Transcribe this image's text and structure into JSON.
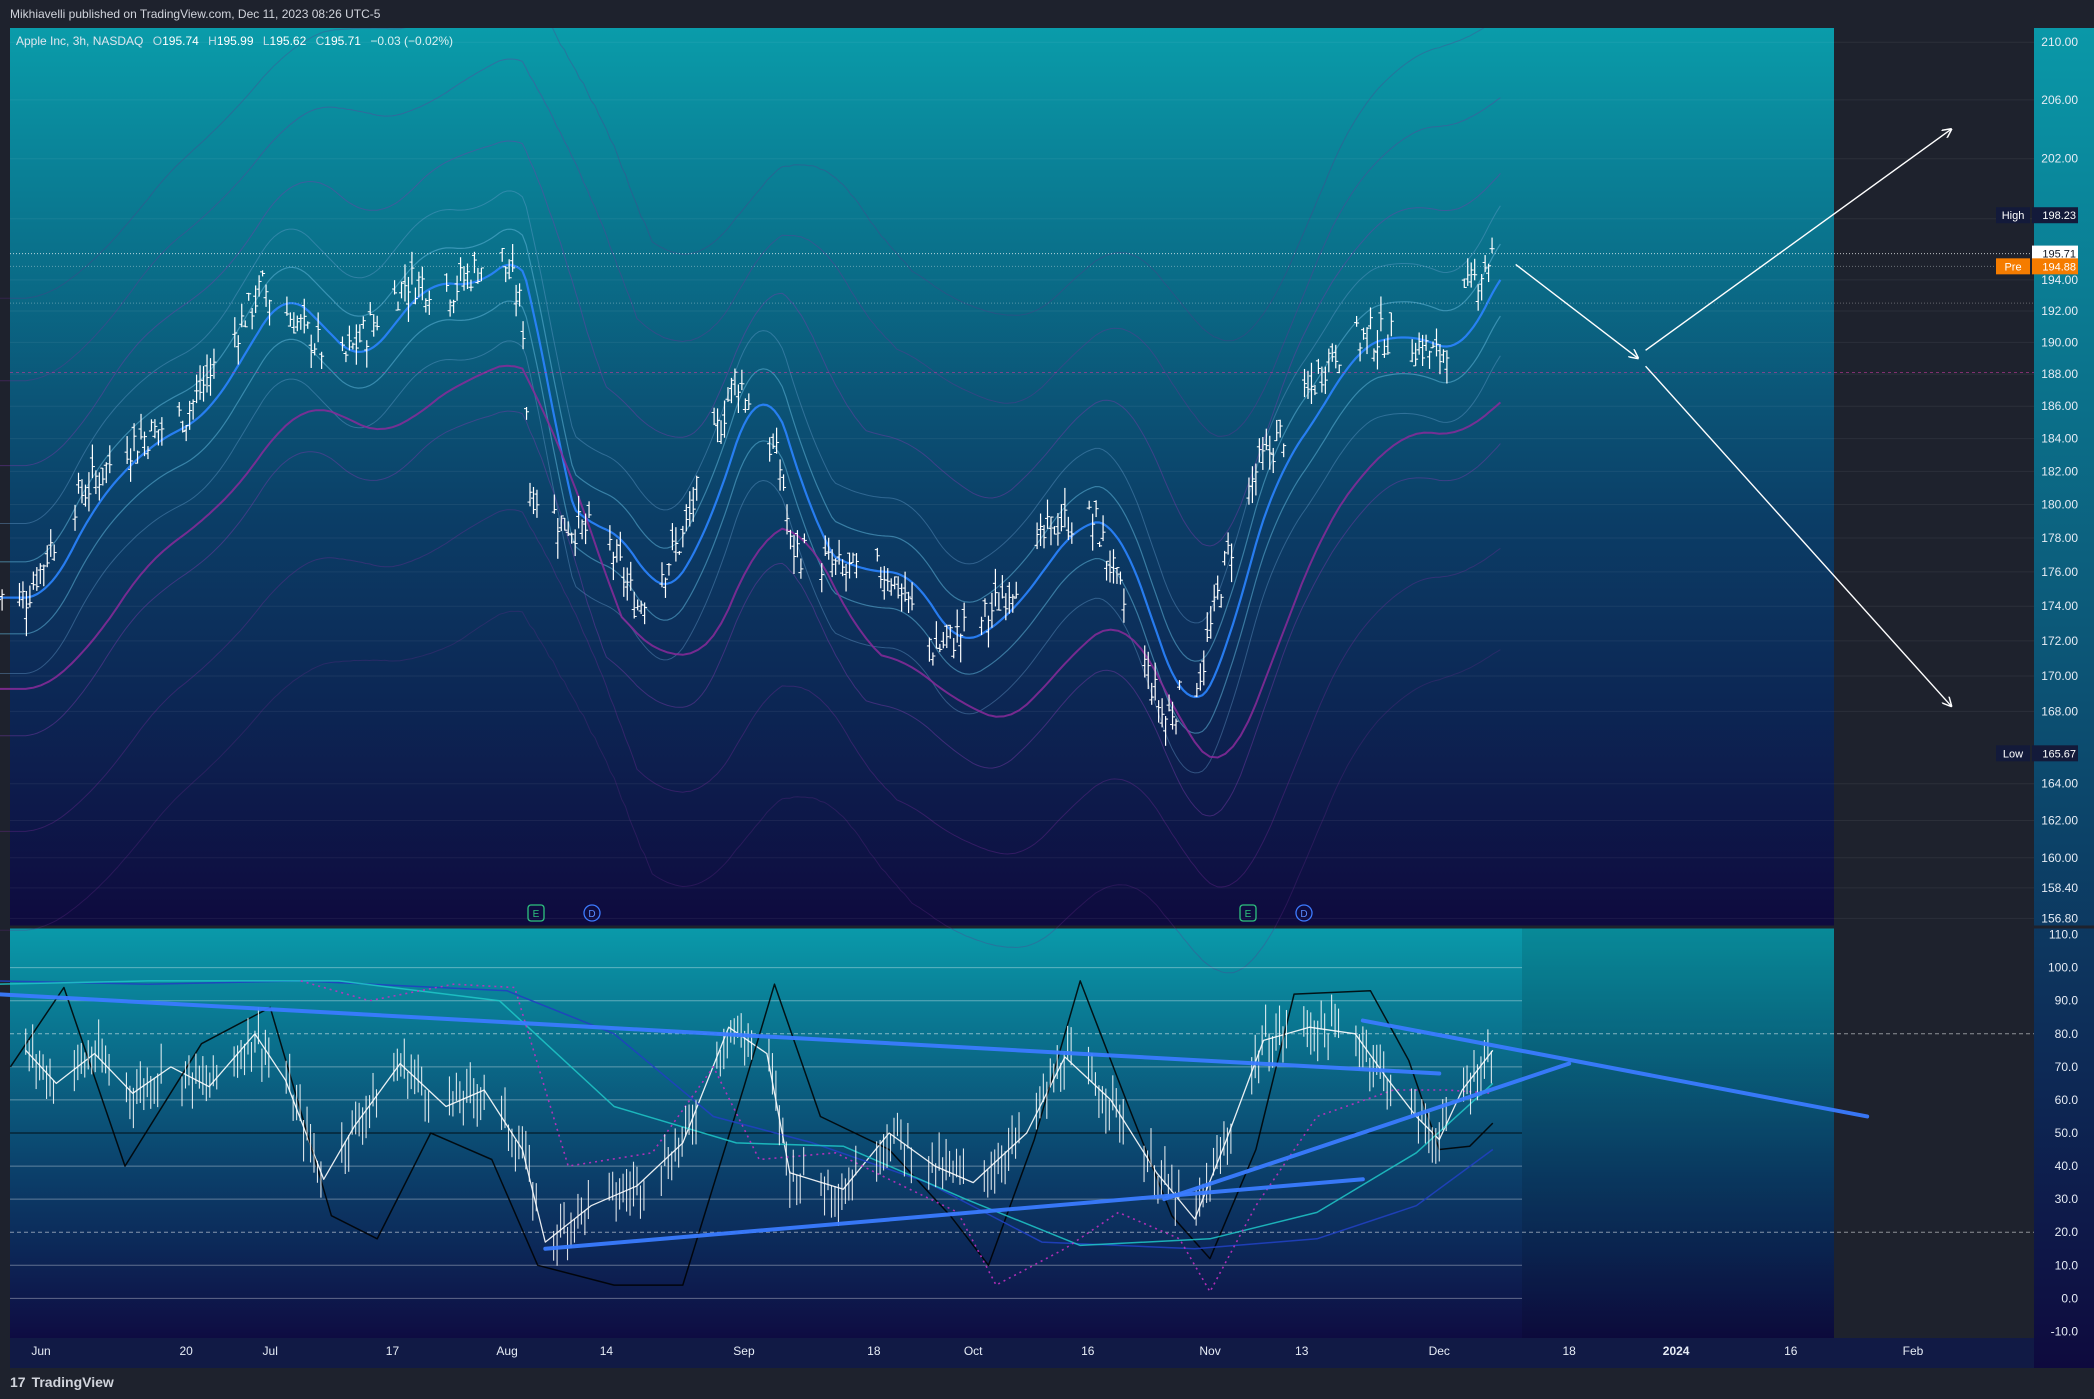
{
  "header": {
    "publisher_line": "Mikhiavelli published on TradingView.com, Dec 11, 2023 08:26 UTC-5"
  },
  "legend": {
    "symbol": "Apple Inc, 3h, NASDAQ",
    "open_label": "O",
    "open": "195.74",
    "high_label": "H",
    "high": "195.99",
    "low_label": "L",
    "low": "195.62",
    "close_label": "C",
    "close": "195.71",
    "change": "−0.03 (−0.02%)"
  },
  "price_markers": {
    "high_label": "High",
    "high": "198.23",
    "last": "195.71",
    "pre_label": "Pre",
    "pre": "194.88",
    "low_label": "Low",
    "low": "165.67"
  },
  "event_markers": [
    "E",
    "D",
    "E",
    "D"
  ],
  "footer": {
    "brand": "TradingView",
    "brand_logo": "17"
  },
  "colors": {
    "bg_top": "#0a9aaa",
    "bg_bottom": "#0e0a3e",
    "candles": "#ffffff",
    "band_blue": "#2a84ff",
    "band_purple": "#8a2a9a",
    "pre_badge": "#f57c00"
  },
  "chart_data": [
    {
      "type": "candlestick",
      "title": "Apple Inc, 3h, NASDAQ",
      "x_ticks": [
        "Jun",
        "20",
        "Jul",
        "17",
        "Aug",
        "14",
        "Sep",
        "18",
        "Oct",
        "16",
        "Nov",
        "13",
        "Dec",
        "18",
        "2024",
        "16",
        "Feb"
      ],
      "y_ticks": [
        210.0,
        206.0,
        202.0,
        198.0,
        194.0,
        192.0,
        190.0,
        188.0,
        186.0,
        184.0,
        182.0,
        180.0,
        178.0,
        176.0,
        174.0,
        172.0,
        170.0,
        168.0,
        164.0,
        162.0,
        160.0,
        158.4,
        156.8
      ],
      "ylim": [
        156.4,
        211.0
      ],
      "y_scale": "log",
      "approx_close_path": [
        {
          "date": "2023-05-30",
          "close": 174.5
        },
        {
          "date": "2023-06-05",
          "close": 180.0
        },
        {
          "date": "2023-06-12",
          "close": 183.5
        },
        {
          "date": "2023-06-20",
          "close": 185.5
        },
        {
          "date": "2023-06-30",
          "close": 193.5
        },
        {
          "date": "2023-07-05",
          "close": 191.0
        },
        {
          "date": "2023-07-10",
          "close": 188.5
        },
        {
          "date": "2023-07-14",
          "close": 191.0
        },
        {
          "date": "2023-07-19",
          "close": 194.0
        },
        {
          "date": "2023-07-25",
          "close": 193.5
        },
        {
          "date": "2023-07-31",
          "close": 196.0
        },
        {
          "date": "2023-08-03",
          "close": 192.0
        },
        {
          "date": "2023-08-04",
          "close": 181.0
        },
        {
          "date": "2023-08-08",
          "close": 179.0
        },
        {
          "date": "2023-08-14",
          "close": 178.0
        },
        {
          "date": "2023-08-18",
          "close": 174.0
        },
        {
          "date": "2023-08-24",
          "close": 178.0
        },
        {
          "date": "2023-08-31",
          "close": 188.0
        },
        {
          "date": "2023-09-06",
          "close": 182.0
        },
        {
          "date": "2023-09-07",
          "close": 177.5
        },
        {
          "date": "2023-09-14",
          "close": 176.0
        },
        {
          "date": "2023-09-20",
          "close": 176.0
        },
        {
          "date": "2023-09-26",
          "close": 171.5
        },
        {
          "date": "2023-10-03",
          "close": 173.5
        },
        {
          "date": "2023-10-12",
          "close": 179.0
        },
        {
          "date": "2023-10-17",
          "close": 179.0
        },
        {
          "date": "2023-10-20",
          "close": 175.0
        },
        {
          "date": "2023-10-26",
          "close": 167.5
        },
        {
          "date": "2023-10-31",
          "close": 170.5
        },
        {
          "date": "2023-11-03",
          "close": 176.5
        },
        {
          "date": "2023-11-07",
          "close": 182.0
        },
        {
          "date": "2023-11-13",
          "close": 186.0
        },
        {
          "date": "2023-11-17",
          "close": 189.5
        },
        {
          "date": "2023-11-22",
          "close": 190.5
        },
        {
          "date": "2023-11-28",
          "close": 190.0
        },
        {
          "date": "2023-12-01",
          "close": 189.0
        },
        {
          "date": "2023-12-05",
          "close": 193.5
        },
        {
          "date": "2023-12-08",
          "close": 195.71
        }
      ],
      "levels": {
        "high": 198.23,
        "last": 195.71,
        "pre": 194.88,
        "low": 165.67
      },
      "annotations": [
        {
          "type": "arrow",
          "from": {
            "date": "2023-12-11",
            "price": 195.0
          },
          "to": {
            "date": "2023-12-27",
            "price": 189.0
          }
        },
        {
          "type": "arrow",
          "from": {
            "date": "2023-12-28",
            "price": 189.5
          },
          "to": {
            "date": "2024-02-06",
            "price": 204.0
          }
        },
        {
          "type": "arrow",
          "from": {
            "date": "2023-12-28",
            "price": 188.5
          },
          "to": {
            "date": "2024-02-06",
            "price": 168.3
          }
        }
      ]
    },
    {
      "type": "line",
      "y_ticks": [
        110.0,
        100.0,
        90.0,
        80.0,
        70.0,
        60.0,
        50.0,
        40.0,
        30.0,
        20.0,
        10.0,
        0.0,
        -10.0
      ],
      "ylim": [
        -12,
        112
      ],
      "reference_levels": [
        100,
        90,
        80,
        70,
        60,
        50,
        40,
        30,
        20,
        10,
        0
      ],
      "trendlines": [
        {
          "from": {
            "date": "2023-05-26",
            "value": 92
          },
          "to": {
            "date": "2023-12-01",
            "value": 68
          }
        },
        {
          "from": {
            "date": "2023-08-06",
            "value": 15
          },
          "to": {
            "date": "2023-11-21",
            "value": 36
          }
        },
        {
          "from": {
            "date": "2023-11-21",
            "value": 84
          },
          "to": {
            "date": "2024-01-26",
            "value": 55
          }
        },
        {
          "from": {
            "date": "2023-10-26",
            "value": 30
          },
          "to": {
            "date": "2023-12-18",
            "value": 71
          }
        }
      ],
      "series": [
        {
          "points": [
            {
              "date": "2023-05-30",
              "value": 75
            },
            {
              "date": "2023-06-03",
              "value": 65
            },
            {
              "date": "2023-06-08",
              "value": 74
            },
            {
              "date": "2023-06-13",
              "value": 62
            },
            {
              "date": "2023-06-18",
              "value": 70
            },
            {
              "date": "2023-06-23",
              "value": 64
            },
            {
              "date": "2023-06-29",
              "value": 80
            },
            {
              "date": "2023-07-03",
              "value": 66
            },
            {
              "date": "2023-07-08",
              "value": 36
            },
            {
              "date": "2023-07-12",
              "value": 52
            },
            {
              "date": "2023-07-18",
              "value": 71
            },
            {
              "date": "2023-07-24",
              "value": 58
            },
            {
              "date": "2023-07-29",
              "value": 63
            },
            {
              "date": "2023-08-03",
              "value": 45
            },
            {
              "date": "2023-08-06",
              "value": 17
            },
            {
              "date": "2023-08-12",
              "value": 28
            },
            {
              "date": "2023-08-18",
              "value": 34
            },
            {
              "date": "2023-08-24",
              "value": 47
            },
            {
              "date": "2023-08-30",
              "value": 82
            },
            {
              "date": "2023-09-04",
              "value": 74
            },
            {
              "date": "2023-09-07",
              "value": 38
            },
            {
              "date": "2023-09-14",
              "value": 33
            },
            {
              "date": "2023-09-20",
              "value": 50
            },
            {
              "date": "2023-09-26",
              "value": 40
            },
            {
              "date": "2023-10-01",
              "value": 35
            },
            {
              "date": "2023-10-08",
              "value": 50
            },
            {
              "date": "2023-10-13",
              "value": 73
            },
            {
              "date": "2023-10-19",
              "value": 60
            },
            {
              "date": "2023-10-25",
              "value": 38
            },
            {
              "date": "2023-10-30",
              "value": 24
            },
            {
              "date": "2023-11-03",
              "value": 47
            },
            {
              "date": "2023-11-08",
              "value": 78
            },
            {
              "date": "2023-11-14",
              "value": 82
            },
            {
              "date": "2023-11-20",
              "value": 80
            },
            {
              "date": "2023-11-24",
              "value": 67
            },
            {
              "date": "2023-11-28",
              "value": 55
            },
            {
              "date": "2023-12-01",
              "value": 48
            },
            {
              "date": "2023-12-04",
              "value": 63
            },
            {
              "date": "2023-12-08",
              "value": 75
            }
          ]
        },
        {
          "points": [
            {
              "date": "2023-05-28",
              "value": 70
            },
            {
              "date": "2023-06-04",
              "value": 94
            },
            {
              "date": "2023-06-12",
              "value": 40
            },
            {
              "date": "2023-06-22",
              "value": 77
            },
            {
              "date": "2023-07-01",
              "value": 88
            },
            {
              "date": "2023-07-09",
              "value": 25
            },
            {
              "date": "2023-07-15",
              "value": 18
            },
            {
              "date": "2023-07-22",
              "value": 50
            },
            {
              "date": "2023-07-30",
              "value": 42
            },
            {
              "date": "2023-08-05",
              "value": 10
            },
            {
              "date": "2023-08-15",
              "value": 4
            },
            {
              "date": "2023-08-24",
              "value": 4
            },
            {
              "date": "2023-09-01",
              "value": 64
            },
            {
              "date": "2023-09-05",
              "value": 95
            },
            {
              "date": "2023-09-11",
              "value": 55
            },
            {
              "date": "2023-09-20",
              "value": 45
            },
            {
              "date": "2023-09-28",
              "value": 25
            },
            {
              "date": "2023-10-03",
              "value": 10
            },
            {
              "date": "2023-10-09",
              "value": 48
            },
            {
              "date": "2023-10-15",
              "value": 96
            },
            {
              "date": "2023-10-21",
              "value": 60
            },
            {
              "date": "2023-10-27",
              "value": 25
            },
            {
              "date": "2023-11-01",
              "value": 12
            },
            {
              "date": "2023-11-07",
              "value": 45
            },
            {
              "date": "2023-11-12",
              "value": 92
            },
            {
              "date": "2023-11-22",
              "value": 93
            },
            {
              "date": "2023-11-27",
              "value": 72
            },
            {
              "date": "2023-12-01",
              "value": 45
            },
            {
              "date": "2023-12-05",
              "value": 46
            },
            {
              "date": "2023-12-08",
              "value": 53
            }
          ]
        },
        {
          "points": [
            {
              "date": "2023-05-26",
              "value": 96
            },
            {
              "date": "2023-06-15",
              "value": 95
            },
            {
              "date": "2023-07-05",
              "value": 96
            },
            {
              "date": "2023-08-01",
              "value": 93
            },
            {
              "date": "2023-08-15",
              "value": 80
            },
            {
              "date": "2023-08-28",
              "value": 55
            },
            {
              "date": "2023-09-10",
              "value": 47
            },
            {
              "date": "2023-09-25",
              "value": 35
            },
            {
              "date": "2023-10-10",
              "value": 17
            },
            {
              "date": "2023-10-30",
              "value": 15
            },
            {
              "date": "2023-11-15",
              "value": 18
            },
            {
              "date": "2023-11-28",
              "value": 28
            },
            {
              "date": "2023-12-08",
              "value": 45
            }
          ]
        },
        {
          "points": [
            {
              "date": "2023-05-26",
              "value": 95
            },
            {
              "date": "2023-06-15",
              "value": 96
            },
            {
              "date": "2023-07-10",
              "value": 96
            },
            {
              "date": "2023-07-31",
              "value": 90
            },
            {
              "date": "2023-08-15",
              "value": 58
            },
            {
              "date": "2023-08-31",
              "value": 47
            },
            {
              "date": "2023-09-14",
              "value": 46
            },
            {
              "date": "2023-09-30",
              "value": 30
            },
            {
              "date": "2023-10-15",
              "value": 16
            },
            {
              "date": "2023-11-01",
              "value": 18
            },
            {
              "date": "2023-11-15",
              "value": 26
            },
            {
              "date": "2023-11-28",
              "value": 44
            },
            {
              "date": "2023-12-08",
              "value": 65
            }
          ]
        },
        {
          "points": [
            {
              "date": "2023-07-05",
              "value": 96
            },
            {
              "date": "2023-07-14",
              "value": 90
            },
            {
              "date": "2023-07-25",
              "value": 95
            },
            {
              "date": "2023-08-02",
              "value": 94
            },
            {
              "date": "2023-08-09",
              "value": 40
            },
            {
              "date": "2023-08-20",
              "value": 44
            },
            {
              "date": "2023-08-28",
              "value": 70
            },
            {
              "date": "2023-09-03",
              "value": 42
            },
            {
              "date": "2023-09-13",
              "value": 44
            },
            {
              "date": "2023-09-20",
              "value": 36
            },
            {
              "date": "2023-09-29",
              "value": 26
            },
            {
              "date": "2023-10-04",
              "value": 4
            },
            {
              "date": "2023-10-13",
              "value": 15
            },
            {
              "date": "2023-10-20",
              "value": 26
            },
            {
              "date": "2023-10-28",
              "value": 18
            },
            {
              "date": "2023-11-01",
              "value": 2
            },
            {
              "date": "2023-11-07",
              "value": 28
            },
            {
              "date": "2023-11-15",
              "value": 55
            },
            {
              "date": "2023-11-25",
              "value": 63
            },
            {
              "date": "2023-12-02",
              "value": 63
            },
            {
              "date": "2023-12-08",
              "value": 62
            }
          ]
        }
      ]
    }
  ]
}
